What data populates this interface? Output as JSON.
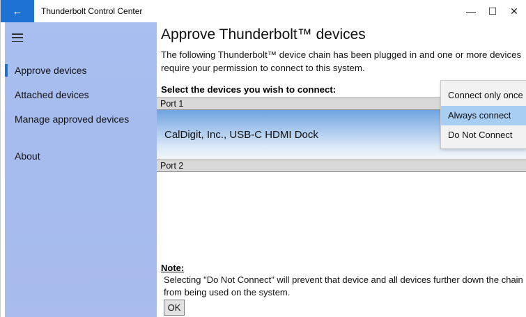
{
  "titlebar": {
    "back_icon": "←",
    "title": "Thunderbolt Control Center",
    "minimize_icon": "—",
    "maximize_icon": "☐",
    "close_icon": "✕",
    "accent_color": "#1e73d2"
  },
  "sidebar": {
    "menu_icon": "hamburger-icon",
    "items": [
      {
        "label": "Approve devices",
        "selected": true
      },
      {
        "label": "Attached devices",
        "selected": false
      },
      {
        "label": "Manage approved devices",
        "selected": false
      },
      {
        "label": "About",
        "selected": false
      }
    ]
  },
  "main": {
    "title": "Approve Thunderbolt™ devices",
    "intro": "The following Thunderbolt™ device chain has been plugged in and one or more devices require your permission to connect to this system.",
    "select_label": "Select the devices you wish to connect:",
    "ports": [
      {
        "label": "Port 1",
        "devices": [
          "CalDigit, Inc., USB-C HDMI Dock"
        ]
      },
      {
        "label": "Port 2",
        "devices": []
      }
    ],
    "note_title": "Note:",
    "note_text": "Selecting \"Do Not Connect\" will prevent that device and all devices further down the chain from being used on the system.",
    "ok_label": "OK"
  },
  "dropdown": {
    "options": [
      "Connect only once",
      "Always connect",
      "Do Not Connect"
    ],
    "selected": "Always connect"
  }
}
